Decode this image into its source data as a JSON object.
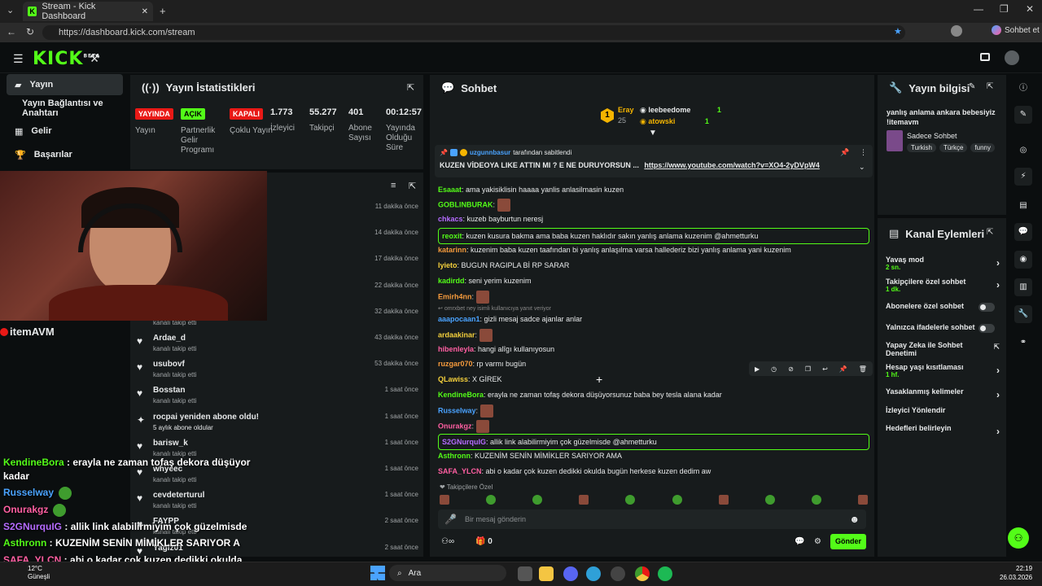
{
  "browser": {
    "tab_title": "Stream - Kick Dashboard",
    "url": "https://dashboard.kick.com/stream",
    "profile_label": "Sohbet et"
  },
  "header": {
    "logo": "KICK",
    "beta": "BETA"
  },
  "nav": {
    "items": [
      "Yayın",
      "Yayın Bağlantısı ve Anahtarı",
      "Gelir",
      "Başarılar"
    ]
  },
  "stats": {
    "title": "Yayın İstatistikleri",
    "items": [
      {
        "badge": "YAYINDA",
        "label": "Yayın",
        "color": "#e91916"
      },
      {
        "badge": "AÇIK",
        "label": "Partnerlik Gelir Programı",
        "color": "#53fc18"
      },
      {
        "badge": "KAPALI",
        "label": "Çoklu Yayın",
        "color": "#e91916"
      },
      {
        "value": "1.773",
        "label": "İzleyici"
      },
      {
        "value": "55.277",
        "label": "Takipçi"
      },
      {
        "value": "401",
        "label": "Abone Sayısı"
      },
      {
        "value": "00:12:57",
        "label": "Yayında Olduğu Süre"
      }
    ]
  },
  "activity": {
    "rows": [
      {
        "time": "11 dakika önce"
      },
      {
        "time": "14 dakika önce"
      },
      {
        "time": "17 dakika önce"
      },
      {
        "time": "22 dakika önce"
      },
      {
        "sub": "kanalı takip etti",
        "time": "32 dakika önce"
      },
      {
        "name": "Ardae_d",
        "sub": "kanalı takip etti",
        "time": "43 dakika önce"
      },
      {
        "name": "usubovf",
        "sub": "kanalı takip etti",
        "time": "53 dakika önce"
      },
      {
        "name": "Bosstan",
        "sub": "kanalı takip etti",
        "time": "1 saat önce"
      },
      {
        "name": "rocpai yeniden abone oldu!",
        "sub": "5 aylık abone oldular",
        "time": "1 saat önce"
      },
      {
        "name": "barisw_k",
        "sub": "kanalı takip etti",
        "time": "1 saat önce"
      },
      {
        "name": "whyeec",
        "sub": "kanalı takip etti",
        "time": "1 saat önce"
      },
      {
        "name": "cevdeterturul",
        "sub": "kanalı takip etti",
        "time": "1 saat önce"
      },
      {
        "name": "FAYPP",
        "sub": "kanalı takip etti",
        "time": "2 saat önce"
      },
      {
        "name": "Yagiz01",
        "time": "2 saat önce"
      }
    ]
  },
  "chat": {
    "title": "Sohbet",
    "top_gifters": [
      {
        "name": "Eray",
        "count": "25"
      },
      {
        "name": "leebeedome",
        "count": "1"
      },
      {
        "name": "atowski",
        "count": "1"
      }
    ],
    "pinned_by": "uzgunnbasur",
    "pinned_suffix": "tarafından sabitlendi",
    "pinned_text": "KUZEN VİDEOYA LIKE ATTIN MI ? E NE DURUYORSUN ...",
    "pinned_link": "https://www.youtube.com/watch?v=XO4-2yDVpW4",
    "messages": [
      {
        "user": "Esaaat",
        "color": "#53fc18",
        "text": "ama yakisiklisin haaaa yanlis anlasilmasin kuzen"
      },
      {
        "user": "GOBLINBURAK",
        "color": "#53fc18",
        "text": ""
      },
      {
        "user": "chkacs",
        "color": "#b56bff",
        "text": "kuzeb bayburtun neresj"
      },
      {
        "user": "reoxit",
        "color": "#53fc18",
        "text": "kuzen kusura bakma ama baba kuzen haklıdır sakın yanlış anlama kuzenim @ahmetturku"
      },
      {
        "user": "katarinn",
        "color": "#f49a3c",
        "text": "kuzenim baba kuzen taafından bi yanlış anlaşılma varsa hallederiz bizi yanlış anlama yani kuzenim"
      },
      {
        "user": "Iyieto",
        "color": "#f4d03c",
        "text": "BUGUN RAGIPLA Bİ RP SARAR"
      },
      {
        "user": "kadirdd",
        "color": "#53fc18",
        "text": "seni yerim kuzenim"
      },
      {
        "user": "Emirh4nn",
        "color": "#f49a3c",
        "text": ""
      },
      {
        "user": "omrxbet",
        "color": "#888888",
        "text": "ney isimli kullanıcıya yanıt veriyor"
      },
      {
        "user": "aaapocaan1",
        "color": "#4aa3ff",
        "text": "gizli mesaj sadce ajanlar anlar"
      },
      {
        "user": "ardaakinar",
        "color": "#f4d03c",
        "text": ""
      },
      {
        "user": "hibenleyla",
        "color": "#ff5fa2",
        "text": "hangi alîgı kullanıyosun"
      },
      {
        "user": "ruzgar070",
        "color": "#f49a3c",
        "text": "rp varmı bugün"
      },
      {
        "user": "QLawiss",
        "color": "#f4d03c",
        "text": "X GİREK"
      },
      {
        "user": "KendineBora",
        "color": "#53fc18",
        "text": "erayla ne zaman tofaş dekora düşüyorsunuz baba bey tesla alana kadar"
      },
      {
        "user": "Russelway",
        "color": "#4aa3ff",
        "text": ""
      },
      {
        "user": "Onurakgz",
        "color": "#ff5fa2",
        "text": ""
      },
      {
        "user": "S2GNurquIG",
        "color": "#b56bff",
        "text": "allik link alabilirmiyim çok güzelmisde @ahmetturku"
      },
      {
        "user": "Asthronn",
        "color": "#53fc18",
        "text": "KUZENİM SENİN MİMİKLER SARIYOR AMA"
      },
      {
        "user": "SAFA_YLCN",
        "color": "#ff5fa2",
        "text": "abi o kadar çok kuzen dedikki okulda bugün herkese kuzen dedim aw"
      }
    ],
    "followers_label": "Takipçilere Özel",
    "input_placeholder": "Bir mesaj gönderin",
    "points": "0",
    "send_label": "Gönder"
  },
  "stream_info": {
    "title": "Yayın bilgisi",
    "stream_title": "yanlış anlama ankara bebesiyiz !itemavm",
    "category": "Sadece Sohbet",
    "tags": [
      "Turkish",
      "Türkçe",
      "funny"
    ]
  },
  "channel_actions": {
    "title": "Kanal Eylemleri",
    "items": [
      {
        "label": "Yavaş mod",
        "sub": "2 sn.",
        "control": "chevron"
      },
      {
        "label": "Takipçilere özel sohbet",
        "sub": "1 dk.",
        "control": "chevron"
      },
      {
        "label": "Abonelere özel sohbet",
        "control": "toggle"
      },
      {
        "label": "Yalnızca ifadelerle sohbet",
        "control": "toggle"
      },
      {
        "label": "Yapay Zeka ile Sohbet Denetimi",
        "control": "external"
      },
      {
        "label": "Hesap yaşı kısıtlaması",
        "sub": "1 hf.",
        "control": "chevron"
      },
      {
        "label": "Yasaklanmış kelimeler",
        "control": "chevron"
      },
      {
        "label": "İzleyici Yönlendir",
        "control": "none"
      },
      {
        "label": "Hedefleri belirleyin",
        "control": "chevron"
      }
    ]
  },
  "overlay": {
    "brand": "itemAVM",
    "lines": [
      {
        "user": "KendineBora",
        "text": "erayla ne zaman tofaş dekora düşüyor"
      },
      {
        "user": "",
        "text": "kadar"
      },
      {
        "user": "Russelway",
        "text": ""
      },
      {
        "user": "Onurakgz",
        "text": ""
      },
      {
        "user": "S2GNurquIG",
        "text": "allik link alabilirmiyim çok güzelmisde"
      },
      {
        "user": "Asthronn",
        "text": "KUZENİM SENİN MİMİKLER SARIYOR A"
      },
      {
        "user": "SAFA_YLCN",
        "text": "abi o kadar çok kuzen dedikki okulda"
      }
    ]
  },
  "taskbar": {
    "weather_temp": "12°C",
    "weather_desc": "Güneşli",
    "search_label": "Ara",
    "time": "22:19",
    "date": "26.03.2026"
  }
}
